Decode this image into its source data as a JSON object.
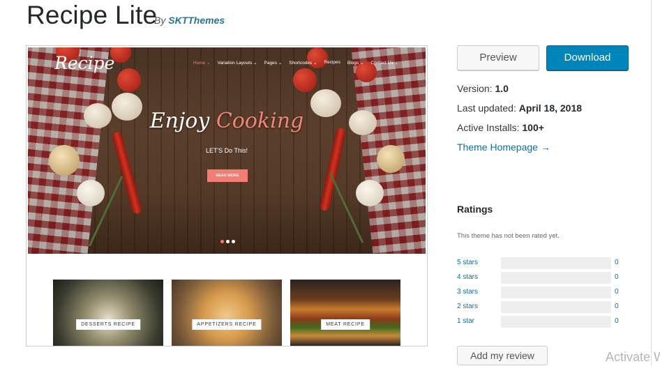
{
  "theme": {
    "title": "Recipe Lite",
    "by_prefix": "By",
    "author": "SKTThemes"
  },
  "preview_screenshot": {
    "logo": "Recipe",
    "nav": [
      "Home ⌄",
      "Variation Layouts ⌄",
      "Pages ⌄",
      "Shortcodes ⌄",
      "Recipes",
      "Blogs ⌄",
      "Contact Us ⌄"
    ],
    "headline_part1": "Enjoy",
    "headline_part2": "Cooking",
    "subline": "LET'S Do This!",
    "read_more": "READ MORE",
    "cards": [
      {
        "label": "DESSERTS RECIPE"
      },
      {
        "label": "APPETIZERS RECIPE"
      },
      {
        "label": "MEAT RECIPE"
      }
    ]
  },
  "actions": {
    "preview_label": "Preview",
    "download_label": "Download"
  },
  "details": {
    "version_label": "Version:",
    "version_value": "1.0",
    "updated_label": "Last updated:",
    "updated_value": "April 18, 2018",
    "installs_label": "Active Installs:",
    "installs_value": "100+",
    "homepage_link": "Theme Homepage →"
  },
  "ratings": {
    "heading": "Ratings",
    "note": "This theme has not been rated yet.",
    "rows": [
      {
        "label": "5 stars",
        "count": "0"
      },
      {
        "label": "4 stars",
        "count": "0"
      },
      {
        "label": "3 stars",
        "count": "0"
      },
      {
        "label": "2 stars",
        "count": "0"
      },
      {
        "label": "1 star",
        "count": "0"
      }
    ],
    "add_review": "Add my review"
  },
  "watermark": "Activate W",
  "colors": {
    "link": "#0073aa",
    "download_button": "#0085ba",
    "accent": "#f27e73"
  }
}
